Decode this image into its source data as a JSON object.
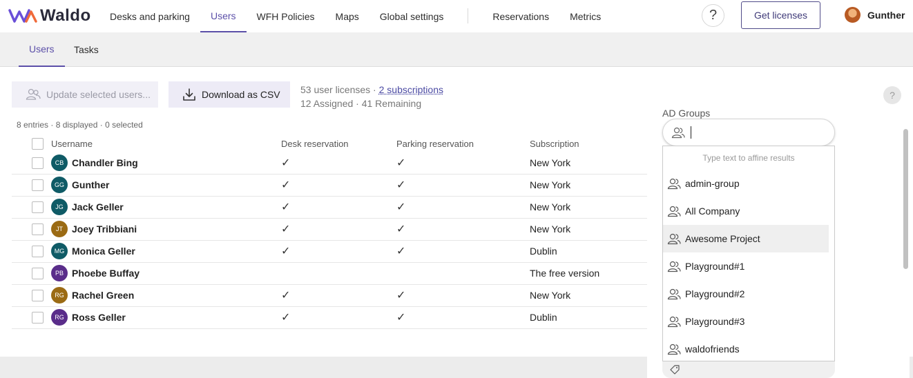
{
  "app": {
    "logo_text": "Waldo"
  },
  "nav": {
    "items": [
      {
        "label": "Desks and parking",
        "active": false
      },
      {
        "label": "Users",
        "active": true
      },
      {
        "label": "WFH Policies",
        "active": false
      },
      {
        "label": "Maps",
        "active": false
      },
      {
        "label": "Global settings",
        "active": false
      }
    ],
    "items_right": [
      {
        "label": "Reservations"
      },
      {
        "label": "Metrics"
      }
    ]
  },
  "header": {
    "help_label": "?",
    "license_button": "Get licenses",
    "user_name": "Gunther"
  },
  "subnav": {
    "tabs": [
      {
        "label": "Users",
        "active": true
      },
      {
        "label": "Tasks",
        "active": false
      }
    ]
  },
  "toolbar": {
    "update_label": "Update selected users...",
    "csv_label": "Download as CSV"
  },
  "license": {
    "count": "53 user licenses · ",
    "subscriptions_link": "2 subscriptions",
    "assigned": "12 Assigned · 41 Remaining"
  },
  "entries_text": "8 entries · 8 displayed · 0 selected",
  "help_small": "?",
  "table": {
    "headers": [
      "Username",
      "Desk reservation",
      "Parking reservation",
      "Subscription"
    ],
    "rows": [
      {
        "initials": "CB",
        "color": "#0f5b66",
        "name": "Chandler Bing",
        "desk": "✓",
        "parking": "✓",
        "subscription": "New York"
      },
      {
        "initials": "GG",
        "color": "#0f5b66",
        "name": "Gunther",
        "desk": "✓",
        "parking": "✓",
        "subscription": "New York"
      },
      {
        "initials": "JG",
        "color": "#0f5b66",
        "name": "Jack Geller",
        "desk": "✓",
        "parking": "✓",
        "subscription": "New York"
      },
      {
        "initials": "JT",
        "color": "#9b6b14",
        "name": "Joey Tribbiani",
        "desk": "✓",
        "parking": "✓",
        "subscription": "New York"
      },
      {
        "initials": "MG",
        "color": "#0f5b66",
        "name": "Monica Geller",
        "desk": "✓",
        "parking": "✓",
        "subscription": "Dublin"
      },
      {
        "initials": "PB",
        "color": "#5a2d8a",
        "name": "Phoebe Buffay",
        "desk": "",
        "parking": "",
        "subscription": "The free version"
      },
      {
        "initials": "RG",
        "color": "#9b6b14",
        "name": "Rachel Green",
        "desk": "✓",
        "parking": "✓",
        "subscription": "New York"
      },
      {
        "initials": "RG",
        "color": "#5a2d8a",
        "name": "Ross Geller",
        "desk": "✓",
        "parking": "✓",
        "subscription": "Dublin"
      }
    ]
  },
  "ad_groups": {
    "label": "AD Groups",
    "input_value": "",
    "hint": "Type text to affine results",
    "options": [
      {
        "label": "admin-group",
        "highlight": false
      },
      {
        "label": "All Company",
        "highlight": false
      },
      {
        "label": "Awesome Project",
        "highlight": true
      },
      {
        "label": "Playground#1",
        "highlight": false
      },
      {
        "label": "Playground#2",
        "highlight": false
      },
      {
        "label": "Playground#3",
        "highlight": false
      },
      {
        "label": "waldofriends",
        "highlight": false
      }
    ]
  },
  "colors": {
    "accent": "#5b4fa8",
    "logo_purple": "#6a4fd8",
    "logo_orange": "#f06a3a"
  },
  "icons": {
    "update": "users-icon",
    "csv": "download-icon",
    "group": "group-icon",
    "tag": "tag-icon"
  }
}
